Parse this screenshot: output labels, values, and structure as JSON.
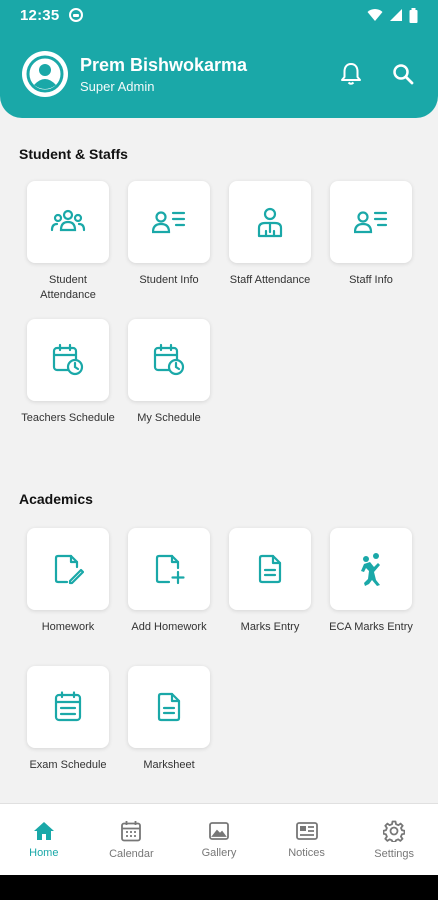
{
  "status_bar": {
    "time": "12:35"
  },
  "header": {
    "user_name": "Prem Bishwokarma",
    "user_role": "Super Admin"
  },
  "colors": {
    "accent": "#1aa8a8",
    "background": "#f2f2f2",
    "text": "#333333"
  },
  "sections": [
    {
      "title": "Student & Staffs",
      "items": [
        {
          "label": "Student Attendance",
          "icon": "group-icon"
        },
        {
          "label": "Student Info",
          "icon": "person-list-icon"
        },
        {
          "label": "Staff Attendance",
          "icon": "staff-icon"
        },
        {
          "label": "Staff Info",
          "icon": "person-list-icon"
        },
        {
          "label": "Teachers Schedule",
          "icon": "calendar-clock-icon"
        },
        {
          "label": "My Schedule",
          "icon": "calendar-clock-icon"
        }
      ]
    },
    {
      "title": "Academics",
      "items": [
        {
          "label": "Homework",
          "icon": "edit-document-icon"
        },
        {
          "label": "Add Homework",
          "icon": "add-document-icon"
        },
        {
          "label": "Marks Entry",
          "icon": "document-icon"
        },
        {
          "label": "ECA Marks Entry",
          "icon": "sports-icon"
        },
        {
          "label": "Exam Schedule",
          "icon": "schedule-list-icon"
        },
        {
          "label": "Marksheet",
          "icon": "document-icon"
        }
      ]
    }
  ],
  "bottom_nav": [
    {
      "label": "Home",
      "icon": "home-icon",
      "active": true
    },
    {
      "label": "Calendar",
      "icon": "calendar-icon",
      "active": false
    },
    {
      "label": "Gallery",
      "icon": "gallery-icon",
      "active": false
    },
    {
      "label": "Notices",
      "icon": "notices-icon",
      "active": false
    },
    {
      "label": "Settings",
      "icon": "settings-icon",
      "active": false
    }
  ]
}
